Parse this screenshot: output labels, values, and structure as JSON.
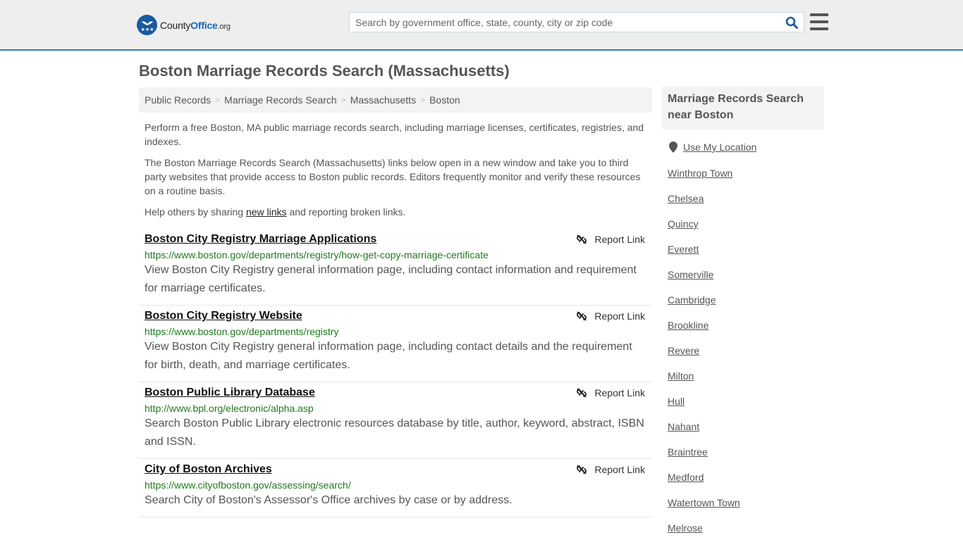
{
  "header": {
    "logo": {
      "brand_county": "County",
      "brand_office": "Office",
      "brand_tld": ".org"
    },
    "search": {
      "placeholder": "Search by government office, state, county, city or zip code",
      "value": ""
    },
    "icons": {
      "search": "search-icon",
      "menu": "hamburger-menu-icon"
    },
    "colors": {
      "accent": "#337ab7",
      "logo_blue": "#1a5a9e"
    }
  },
  "page": {
    "title": "Boston Marriage Records Search (Massachusetts)",
    "breadcrumb": [
      "Public Records",
      "Marriage Records Search",
      "Massachusetts",
      "Boston"
    ],
    "intro": {
      "p1": "Perform a free Boston, MA public marriage records search, including marriage licenses, certificates, registries, and indexes.",
      "p2": "The Boston Marriage Records Search (Massachusetts) links below open in a new window and take you to third party websites that provide access to Boston public records. Editors frequently monitor and verify these resources on a routine basis.",
      "p3_before": "Help others by sharing ",
      "p3_link": "new links",
      "p3_after": " and reporting broken links."
    }
  },
  "results": [
    {
      "title": "Boston City Registry Marriage Applications",
      "url": "https://www.boston.gov/departments/registry/how-get-copy-marriage-certificate",
      "description": "View Boston City Registry general information page, including contact information and requirement for marriage certificates.",
      "report_label": "Report Link"
    },
    {
      "title": "Boston City Registry Website",
      "url": "https://www.boston.gov/departments/registry",
      "description": "View Boston City Registry general information page, including contact details and the requirement for birth, death, and marriage certificates.",
      "report_label": "Report Link"
    },
    {
      "title": "Boston Public Library Database",
      "url": "http://www.bpl.org/electronic/alpha.asp",
      "description": "Search Boston Public Library electronic resources database by title, author, keyword, abstract, ISBN and ISSN.",
      "report_label": "Report Link"
    },
    {
      "title": "City of Boston Archives",
      "url": "https://www.cityofboston.gov/assessing/search/",
      "description": "Search City of Boston's Assessor's Office archives by case or by address.",
      "report_label": "Report Link"
    }
  ],
  "sidebar": {
    "heading": "Marriage Records Search near Boston",
    "use_location": "Use My Location",
    "nearby": [
      "Winthrop Town",
      "Chelsea",
      "Quincy",
      "Everett",
      "Somerville",
      "Cambridge",
      "Brookline",
      "Revere",
      "Milton",
      "Hull",
      "Nahant",
      "Braintree",
      "Medford",
      "Watertown Town",
      "Melrose"
    ]
  }
}
